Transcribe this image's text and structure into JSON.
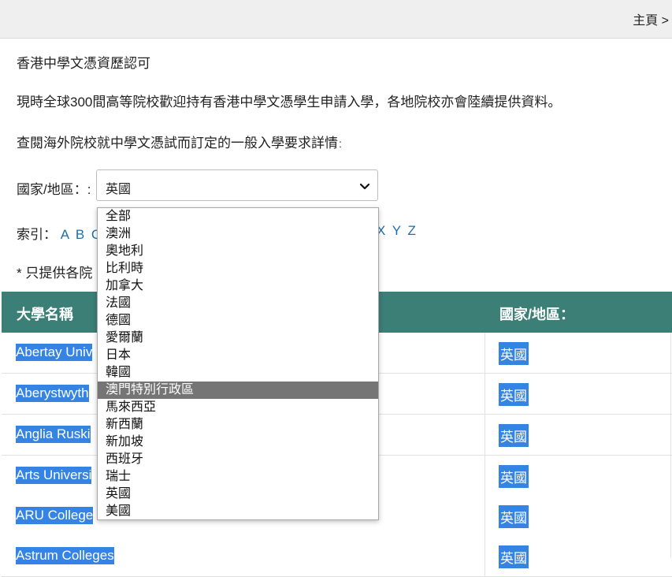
{
  "header": {
    "home_link": "主頁 >"
  },
  "intro": {
    "title": "香港中學文憑資歷認可",
    "paragraph": "現時全球300間高等院校歡迎持有香港中學文憑學生申請入學，各地院校亦會陸續提供資料。",
    "lookup_text": "查閱海外院校就中學文憑試而訂定的一般入學要求詳情",
    "lookup_colon": "："
  },
  "filter": {
    "label": "國家/地區：:",
    "selected": "英國",
    "options": [
      "全部",
      "澳洲",
      "奧地利",
      "比利時",
      "加拿大",
      "法國",
      "德國",
      "愛爾蘭",
      "日本",
      "韓國",
      "澳門特別行政區",
      "馬來西亞",
      "新西蘭",
      "新加坡",
      "西班牙",
      "瑞士",
      "英國",
      "美國"
    ],
    "highlighted": "澳門特別行政區"
  },
  "index": {
    "label": "索引：",
    "letters_visible_left": "A B C",
    "letters_visible_right": "X Y Z"
  },
  "note": "* 只提供各院",
  "table": {
    "headers": {
      "name": "大學名稱",
      "country": "國家/地區："
    },
    "rows": [
      {
        "name": "Abertay Univ",
        "country": "英國"
      },
      {
        "name": "Aberystwyth",
        "country": "英國"
      },
      {
        "name": "Anglia Ruski",
        "country": "英國"
      },
      {
        "name": "Arts Universi",
        "country": "英國"
      },
      {
        "name": "ARU College",
        "country": "英國"
      },
      {
        "name": "Astrum Colleges",
        "country": "英國"
      }
    ]
  },
  "colors": {
    "header_bg": "#3b7f77",
    "selection": "#3584e4",
    "link": "#1f6ea8",
    "highlight": "#757575"
  }
}
